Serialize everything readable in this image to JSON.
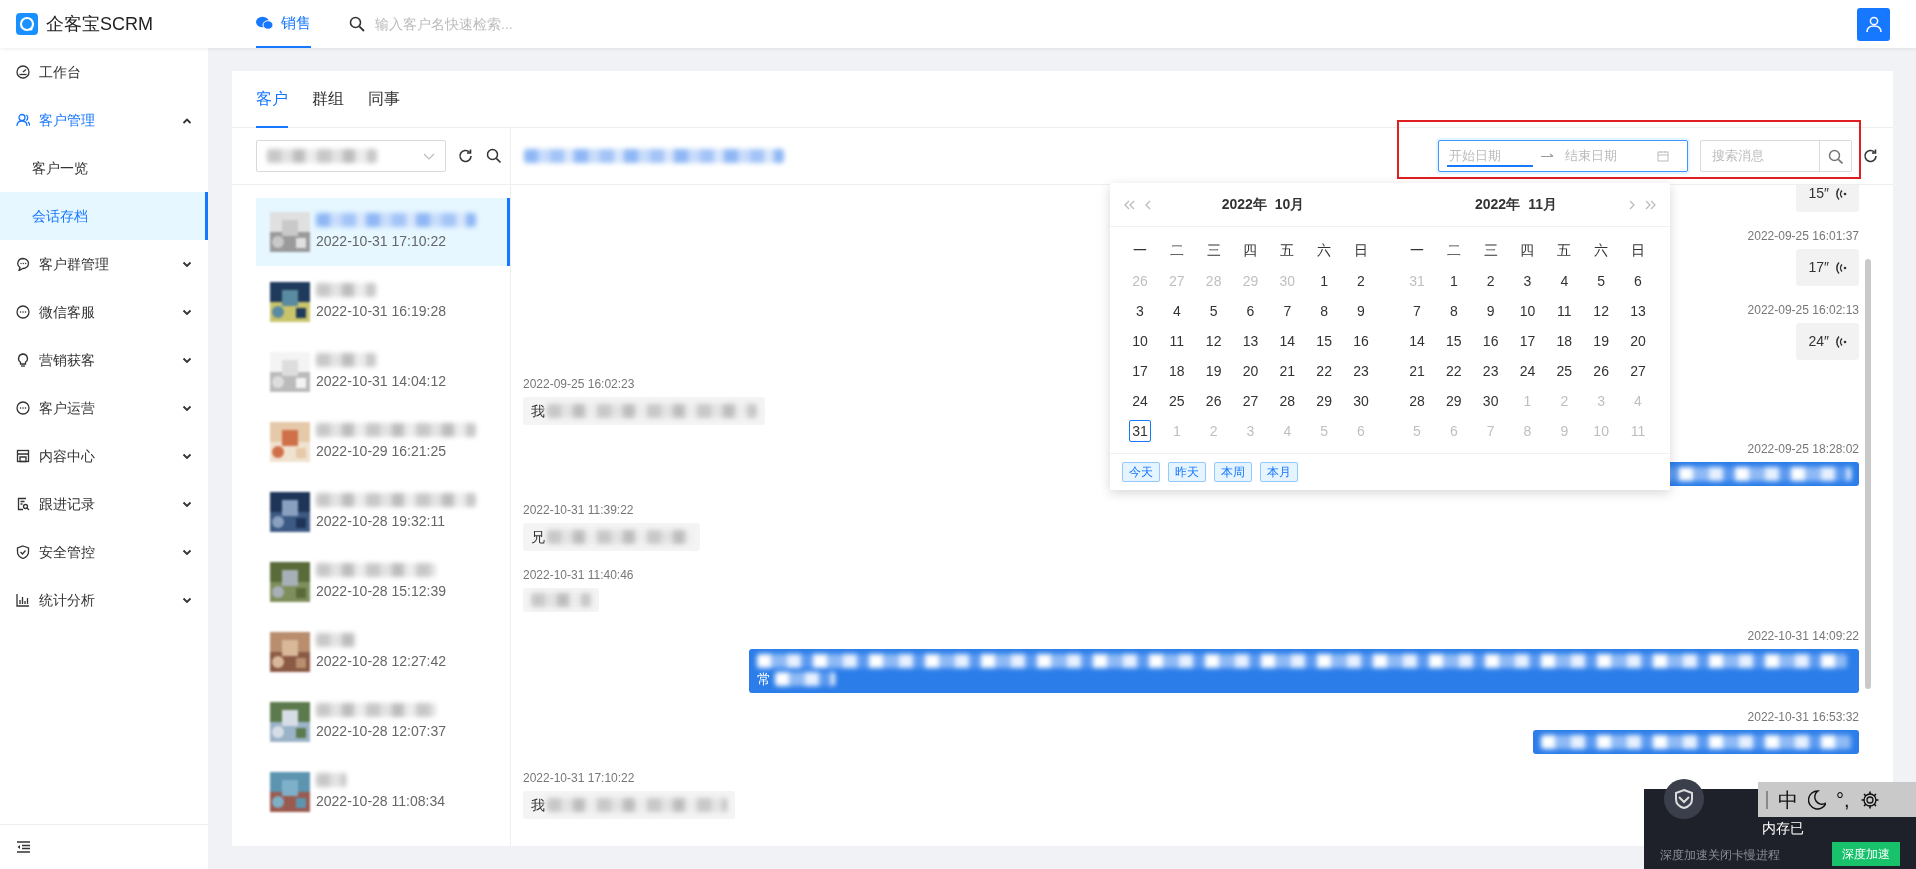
{
  "app": {
    "logo_text": "企客宝SCRM"
  },
  "top_nav": {
    "tabs": [
      {
        "label": "销售",
        "selected": true
      }
    ],
    "search": {
      "placeholder": "输入客户名快速检索..."
    }
  },
  "sidebar": {
    "items": [
      {
        "label": "工作台"
      },
      {
        "label": "客户管理",
        "expanded": true,
        "children": [
          {
            "label": "客户一览",
            "selected": false
          },
          {
            "label": "会话存档",
            "selected": true
          }
        ]
      },
      {
        "label": "客户群管理",
        "expanded": false
      },
      {
        "label": "微信客服",
        "expanded": false
      },
      {
        "label": "营销获客",
        "expanded": false
      },
      {
        "label": "客户运营",
        "expanded": false
      },
      {
        "label": "内容中心",
        "expanded": false
      },
      {
        "label": "跟进记录",
        "expanded": false
      },
      {
        "label": "安全管控",
        "expanded": false
      },
      {
        "label": "统计分析",
        "expanded": false
      }
    ]
  },
  "tabs": [
    {
      "label": "客户",
      "selected": true
    },
    {
      "label": "群组",
      "selected": false
    },
    {
      "label": "同事",
      "selected": false
    }
  ],
  "contacts": [
    {
      "time": "2022-10-31 17:10:22",
      "selected": true
    },
    {
      "time": "2022-10-31 16:19:28",
      "selected": false
    },
    {
      "time": "2022-10-31 14:04:12",
      "selected": false
    },
    {
      "time": "2022-10-29 16:21:25",
      "selected": false
    },
    {
      "time": "2022-10-28 19:32:11",
      "selected": false
    },
    {
      "time": "2022-10-28 15:12:39",
      "selected": false
    },
    {
      "time": "2022-10-28 12:27:42",
      "selected": false
    },
    {
      "time": "2022-10-28 12:07:37",
      "selected": false
    },
    {
      "time": "2022-10-28 11:08:34",
      "selected": false
    }
  ],
  "chat_toolbar": {
    "start_placeholder": "开始日期",
    "end_placeholder": "结束日期",
    "search_placeholder": "搜索消息"
  },
  "messages": [
    {
      "from_me": true,
      "kind": "voice",
      "duration": "15″"
    },
    {
      "from_me": true,
      "kind": "voice",
      "time": "2022-09-25 16:01:37",
      "duration": "17″"
    },
    {
      "from_me": true,
      "kind": "voice",
      "time": "2022-09-25 16:02:13",
      "duration": "24″"
    },
    {
      "from_me": false,
      "kind": "text",
      "time": "2022-09-25 16:02:23",
      "text": "我"
    },
    {
      "from_me": true,
      "kind": "text",
      "time": "2022-09-25 18:28:02"
    },
    {
      "from_me": false,
      "kind": "text",
      "time": "2022-10-31 11:39:22",
      "text": "兄"
    },
    {
      "from_me": false,
      "kind": "text",
      "time": "2022-10-31 11:40:46"
    },
    {
      "from_me": true,
      "kind": "text",
      "time": "2022-10-31 14:09:22",
      "text": "常"
    },
    {
      "from_me": true,
      "kind": "text",
      "time": "2022-10-31 16:53:32"
    },
    {
      "from_me": false,
      "kind": "text",
      "time": "2022-10-31 17:10:22",
      "text": "我"
    }
  ],
  "date_picker": {
    "months": [
      {
        "year": "2022年",
        "month": "10月",
        "weekdays": [
          "一",
          "二",
          "三",
          "四",
          "五",
          "六",
          "日"
        ],
        "days": [
          {
            "t": "26",
            "muted": true
          },
          {
            "t": "27",
            "muted": true
          },
          {
            "t": "28",
            "muted": true
          },
          {
            "t": "29",
            "muted": true
          },
          {
            "t": "30",
            "muted": true
          },
          {
            "t": "1",
            "muted": false
          },
          {
            "t": "2",
            "muted": false
          },
          {
            "t": "3",
            "muted": false
          },
          {
            "t": "4",
            "muted": false
          },
          {
            "t": "5",
            "muted": false
          },
          {
            "t": "6",
            "muted": false
          },
          {
            "t": "7",
            "muted": false
          },
          {
            "t": "8",
            "muted": false
          },
          {
            "t": "9",
            "muted": false
          },
          {
            "t": "10",
            "muted": false
          },
          {
            "t": "11",
            "muted": false
          },
          {
            "t": "12",
            "muted": false
          },
          {
            "t": "13",
            "muted": false
          },
          {
            "t": "14",
            "muted": false
          },
          {
            "t": "15",
            "muted": false
          },
          {
            "t": "16",
            "muted": false
          },
          {
            "t": "17",
            "muted": false
          },
          {
            "t": "18",
            "muted": false
          },
          {
            "t": "19",
            "muted": false
          },
          {
            "t": "20",
            "muted": false
          },
          {
            "t": "21",
            "muted": false
          },
          {
            "t": "22",
            "muted": false
          },
          {
            "t": "23",
            "muted": false
          },
          {
            "t": "24",
            "muted": false
          },
          {
            "t": "25",
            "muted": false
          },
          {
            "t": "26",
            "muted": false
          },
          {
            "t": "27",
            "muted": false
          },
          {
            "t": "28",
            "muted": false
          },
          {
            "t": "29",
            "muted": false
          },
          {
            "t": "30",
            "muted": false
          },
          {
            "t": "31",
            "muted": false,
            "today": true
          },
          {
            "t": "1",
            "muted": true
          },
          {
            "t": "2",
            "muted": true
          },
          {
            "t": "3",
            "muted": true
          },
          {
            "t": "4",
            "muted": true
          },
          {
            "t": "5",
            "muted": true
          },
          {
            "t": "6",
            "muted": true
          }
        ]
      },
      {
        "year": "2022年",
        "month": "11月",
        "weekdays": [
          "一",
          "二",
          "三",
          "四",
          "五",
          "六",
          "日"
        ],
        "days": [
          {
            "t": "31",
            "muted": true
          },
          {
            "t": "1",
            "muted": false
          },
          {
            "t": "2",
            "muted": false
          },
          {
            "t": "3",
            "muted": false
          },
          {
            "t": "4",
            "muted": false
          },
          {
            "t": "5",
            "muted": false
          },
          {
            "t": "6",
            "muted": false
          },
          {
            "t": "7",
            "muted": false
          },
          {
            "t": "8",
            "muted": false
          },
          {
            "t": "9",
            "muted": false
          },
          {
            "t": "10",
            "muted": false
          },
          {
            "t": "11",
            "muted": false
          },
          {
            "t": "12",
            "muted": false
          },
          {
            "t": "13",
            "muted": false
          },
          {
            "t": "14",
            "muted": false
          },
          {
            "t": "15",
            "muted": false
          },
          {
            "t": "16",
            "muted": false
          },
          {
            "t": "17",
            "muted": false
          },
          {
            "t": "18",
            "muted": false
          },
          {
            "t": "19",
            "muted": false
          },
          {
            "t": "20",
            "muted": false
          },
          {
            "t": "21",
            "muted": false
          },
          {
            "t": "22",
            "muted": false
          },
          {
            "t": "23",
            "muted": false
          },
          {
            "t": "24",
            "muted": false
          },
          {
            "t": "25",
            "muted": false
          },
          {
            "t": "26",
            "muted": false
          },
          {
            "t": "27",
            "muted": false
          },
          {
            "t": "28",
            "muted": false
          },
          {
            "t": "29",
            "muted": false
          },
          {
            "t": "30",
            "muted": false
          },
          {
            "t": "1",
            "muted": true
          },
          {
            "t": "2",
            "muted": true
          },
          {
            "t": "3",
            "muted": true
          },
          {
            "t": "4",
            "muted": true
          },
          {
            "t": "5",
            "muted": true
          },
          {
            "t": "6",
            "muted": true
          },
          {
            "t": "7",
            "muted": true
          },
          {
            "t": "8",
            "muted": true
          },
          {
            "t": "9",
            "muted": true
          },
          {
            "t": "10",
            "muted": true
          },
          {
            "t": "11",
            "muted": true
          }
        ]
      }
    ],
    "shortcuts": [
      "今天",
      "昨天",
      "本周",
      "本月"
    ]
  },
  "notification": {
    "title": "内存已",
    "text": "深度加速关闭卡慢进程",
    "button": "深度加速"
  },
  "ime_bar": {
    "mode": "中",
    "punctuation": "°,"
  }
}
